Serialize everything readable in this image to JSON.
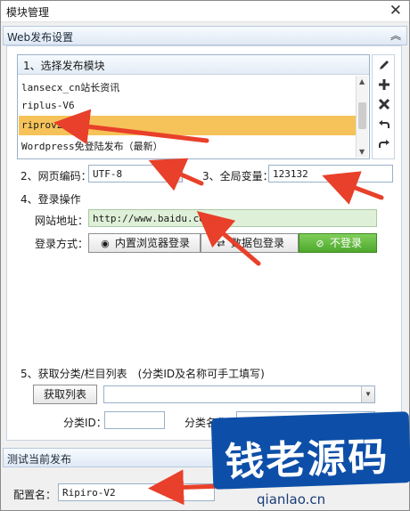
{
  "window": {
    "title": "模块管理",
    "close_label": "✕"
  },
  "web_section": {
    "label": "Web发布设置",
    "collapse_icon": "chevron-up-double"
  },
  "step1": {
    "label": "1、选择发布模块"
  },
  "modules": [
    {
      "name": "lansecx_cn站长资讯",
      "selected": false
    },
    {
      "name": "riplus-V6",
      "selected": false
    },
    {
      "name": "riprov2",
      "selected": true
    },
    {
      "name": "Wordpress免登陆发布（最新）",
      "selected": false
    }
  ],
  "toolbar_icons": [
    "edit-icon",
    "add-icon",
    "delete-icon",
    "undo-icon",
    "redo-icon"
  ],
  "encoding": {
    "label": "2、网页编码：",
    "value": "UTF-8"
  },
  "global_var": {
    "label": "3、全局变量：",
    "value": "123132"
  },
  "login": {
    "label": "4、登录操作",
    "site_label": "网站地址：",
    "site_value": "http://www.baidu.com",
    "method_label": "登录方式：",
    "buttons": [
      "内置浏览器登录",
      "数据包登录",
      "不登录"
    ]
  },
  "step5": {
    "label": "5、获取分类/栏目列表　(分类ID及名称可手工填写)",
    "fetch_button": "获取列表",
    "category_id_label": "分类ID：",
    "category_name_label": "分类名称："
  },
  "test_section": {
    "label": "测试当前发布"
  },
  "config": {
    "label": "配置名：",
    "value": "Ripiro-V2"
  },
  "watermark": {
    "text": "钱老源码",
    "url": "qianlao.cn"
  },
  "colors": {
    "selected_row": "#f6c35a",
    "green_button": "#4ea82d",
    "arrow": "#e8402a",
    "watermark": "#0d4fa8"
  }
}
